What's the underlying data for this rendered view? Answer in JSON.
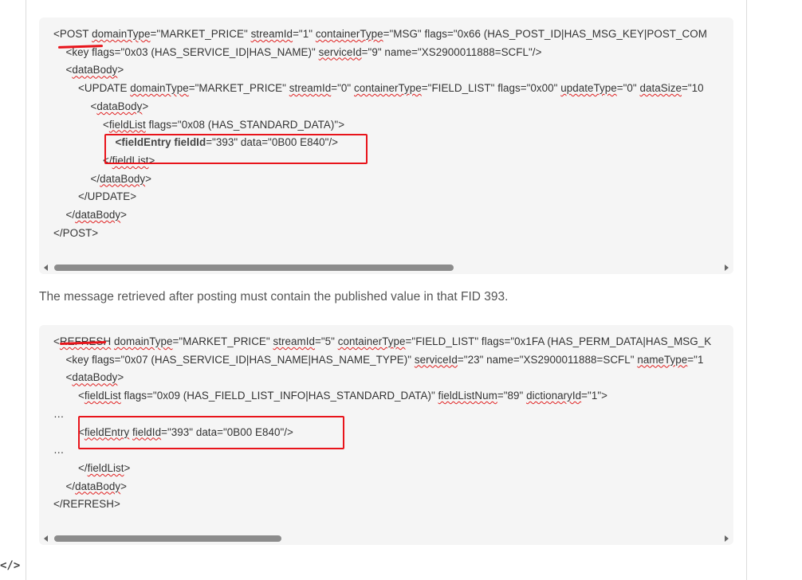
{
  "code_blocks": [
    {
      "lines": [
        {
          "indent": 0,
          "segments": [
            [
              "<",
              ""
            ],
            [
              "POST",
              ""
            ],
            [
              " ",
              ""
            ],
            [
              "domainType",
              "sq"
            ],
            [
              "=\"MARKET_PRICE\" ",
              ""
            ],
            [
              "streamId",
              "sq"
            ],
            [
              "=\"1\" ",
              ""
            ],
            [
              "containerType",
              "sq"
            ],
            [
              "=\"MSG\" flags=\"0x66 (HAS_POST_ID|HAS_MSG_KEY|POST_COM",
              ""
            ]
          ]
        },
        {
          "indent": 1,
          "segments": [
            [
              "<key flags=\"0x03 (HAS_SERVICE_ID|HAS_NAME)\" ",
              ""
            ],
            [
              "serviceId",
              "sq"
            ],
            [
              "=\"9\" name=\"XS2900011888=SCFL\"/>",
              ""
            ]
          ]
        },
        {
          "indent": 1,
          "segments": [
            [
              "<",
              ""
            ],
            [
              "dataBody",
              "sq"
            ],
            [
              ">",
              ""
            ]
          ]
        },
        {
          "indent": 2,
          "segments": [
            [
              "<UPDATE ",
              ""
            ],
            [
              "domainType",
              "sq"
            ],
            [
              "=\"MARKET_PRICE\" ",
              ""
            ],
            [
              "streamId",
              "sq"
            ],
            [
              "=\"0\" ",
              ""
            ],
            [
              "containerType",
              "sq"
            ],
            [
              "=\"FIELD_LIST\" flags=\"0x00\" ",
              ""
            ],
            [
              "updateType",
              "sq"
            ],
            [
              "=\"0\" ",
              ""
            ],
            [
              "dataSize",
              "sq"
            ],
            [
              "=\"10",
              ""
            ]
          ]
        },
        {
          "indent": 3,
          "segments": [
            [
              "<",
              ""
            ],
            [
              "dataBody",
              "sq"
            ],
            [
              ">",
              ""
            ]
          ]
        },
        {
          "indent": 4,
          "segments": [
            [
              "<",
              ""
            ],
            [
              "fieldList",
              "sq"
            ],
            [
              " flags=\"0x08 (HAS_STANDARD_DATA)\">",
              ""
            ]
          ]
        },
        {
          "indent": 5,
          "segments": [
            [
              "<fieldEntry ",
              "bold"
            ],
            [
              "fieldId",
              "bold"
            ],
            [
              "=\"393\" data=\"0B00 E840\"/>",
              ""
            ]
          ]
        },
        {
          "indent": 4,
          "segments": [
            [
              "</",
              ""
            ],
            [
              "fieldList",
              "sq"
            ],
            [
              ">",
              ""
            ]
          ]
        },
        {
          "indent": 3,
          "segments": [
            [
              "</",
              ""
            ],
            [
              "dataBody",
              "sq"
            ],
            [
              ">",
              ""
            ]
          ]
        },
        {
          "indent": 2,
          "segments": [
            [
              "</UPDATE>",
              ""
            ]
          ]
        },
        {
          "indent": 1,
          "segments": [
            [
              "</",
              ""
            ],
            [
              "dataBody",
              "sq"
            ],
            [
              ">",
              ""
            ]
          ]
        },
        {
          "indent": 0,
          "segments": [
            [
              "</POST>",
              ""
            ]
          ]
        }
      ]
    },
    {
      "lines": [
        {
          "indent": 0,
          "segments": [
            [
              "<",
              ""
            ],
            [
              "REFRESH",
              "sq"
            ],
            [
              " ",
              ""
            ],
            [
              "domainType",
              "sq"
            ],
            [
              "=\"MARKET_PRICE\" ",
              ""
            ],
            [
              "streamId",
              "sq"
            ],
            [
              "=\"5\" ",
              ""
            ],
            [
              "containerType",
              "sq"
            ],
            [
              "=\"FIELD_LIST\" flags=\"0x1FA (HAS_PERM_DATA|HAS_MSG_K",
              ""
            ]
          ]
        },
        {
          "indent": 1,
          "segments": [
            [
              "<key flags=\"0x07 (HAS_SERVICE_ID|HAS_NAME|HAS_NAME_TYPE)\" ",
              ""
            ],
            [
              "serviceId",
              "sq"
            ],
            [
              "=\"23\" name=\"XS2900011888=SCFL\" ",
              ""
            ],
            [
              "nameType",
              "sq"
            ],
            [
              "=\"1",
              ""
            ]
          ]
        },
        {
          "indent": 1,
          "segments": [
            [
              "<",
              ""
            ],
            [
              "dataBody",
              "sq"
            ],
            [
              ">",
              ""
            ]
          ]
        },
        {
          "indent": 2,
          "segments": [
            [
              "<",
              ""
            ],
            [
              "fieldList",
              "sq"
            ],
            [
              " flags=\"0x09 (HAS_FIELD_LIST_INFO|HAS_STANDARD_DATA)\" ",
              ""
            ],
            [
              "fieldListNum",
              "sq"
            ],
            [
              "=\"89\" ",
              ""
            ],
            [
              "dictionaryId",
              "sq"
            ],
            [
              "=\"1\">",
              ""
            ]
          ]
        },
        {
          "indent": 0,
          "segments": [
            [
              "…",
              ""
            ]
          ]
        },
        {
          "indent": 2,
          "segments": [
            [
              "<",
              ""
            ],
            [
              "fieldEntry",
              "sq"
            ],
            [
              " ",
              ""
            ],
            [
              "fieldId",
              "sq"
            ],
            [
              "=\"393\" data=\"0B00 E840\"/>",
              ""
            ]
          ]
        },
        {
          "indent": 0,
          "segments": [
            [
              "…",
              ""
            ]
          ]
        },
        {
          "indent": 2,
          "segments": [
            [
              "</",
              ""
            ],
            [
              "fieldList",
              "sq"
            ],
            [
              ">",
              ""
            ]
          ]
        },
        {
          "indent": 1,
          "segments": [
            [
              "</",
              ""
            ],
            [
              "dataBody",
              "sq"
            ],
            [
              ">",
              ""
            ]
          ]
        },
        {
          "indent": 0,
          "segments": [
            [
              "</REFRESH>",
              ""
            ]
          ]
        }
      ]
    }
  ],
  "caption": "The message retrieved after posting must contain the published value in that FID 393.",
  "embed_icon": "</>",
  "colors": {
    "highlight": "#e8141b",
    "squiggle": "#e02020",
    "code_bg": "#f5f5f5"
  }
}
